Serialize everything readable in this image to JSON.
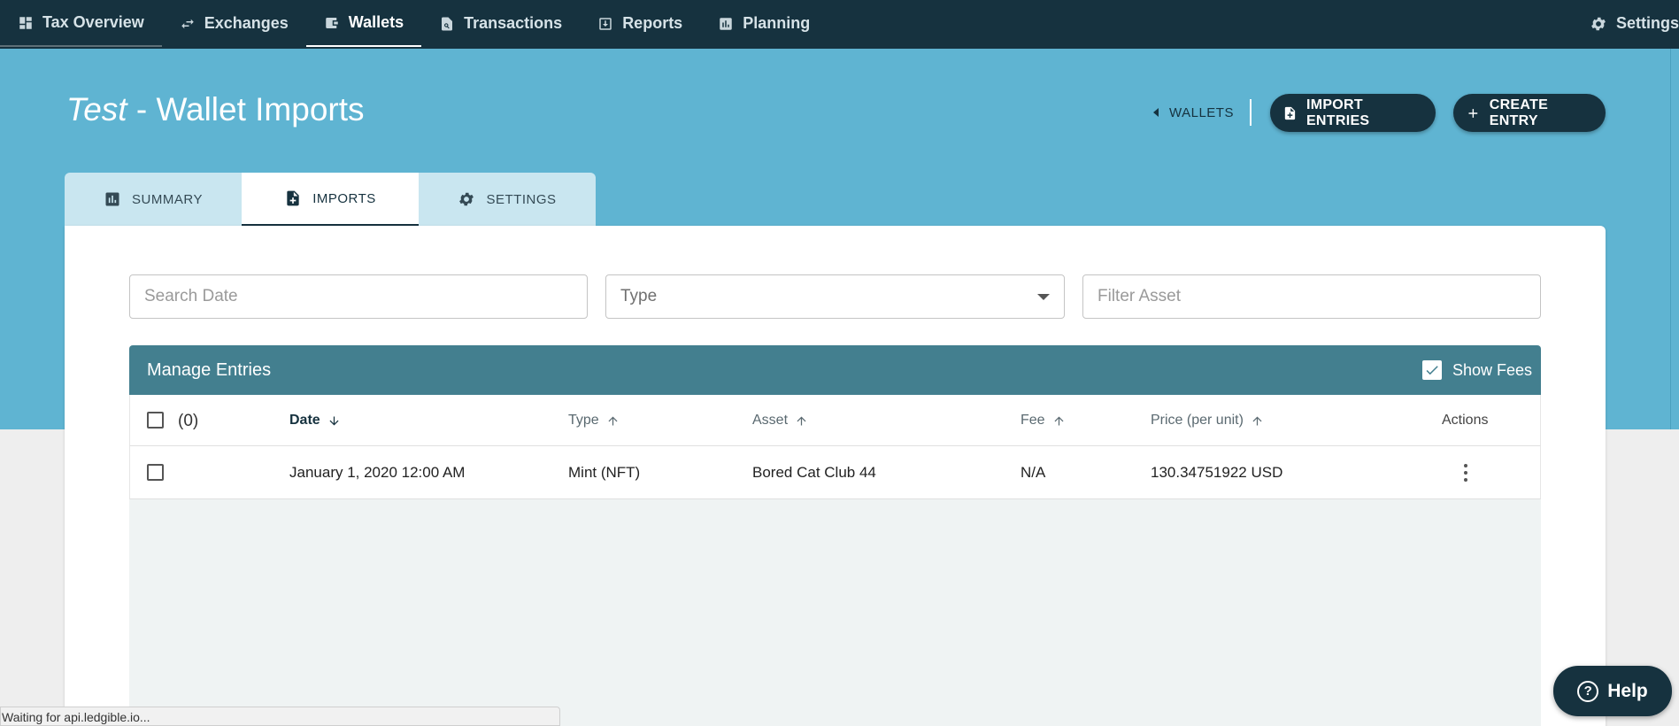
{
  "nav": {
    "items": [
      {
        "label": "Tax Overview",
        "icon": "dashboard-icon"
      },
      {
        "label": "Exchanges",
        "icon": "swap-icon"
      },
      {
        "label": "Wallets",
        "icon": "wallet-icon",
        "active": true
      },
      {
        "label": "Transactions",
        "icon": "search-document-icon"
      },
      {
        "label": "Reports",
        "icon": "report-download-icon"
      },
      {
        "label": "Planning",
        "icon": "bar-chart-icon"
      }
    ],
    "settings_label": "Settings"
  },
  "header": {
    "title_italic": "Test",
    "title_rest": " - Wallet Imports",
    "back_label": "WALLETS",
    "import_label": "IMPORT ENTRIES",
    "create_label": "CREATE ENTRY"
  },
  "tabs": [
    {
      "label": "SUMMARY",
      "icon": "bar-chart-icon"
    },
    {
      "label": "IMPORTS",
      "icon": "file-add-icon",
      "active": true
    },
    {
      "label": "SETTINGS",
      "icon": "gear-icon"
    }
  ],
  "filters": {
    "date_placeholder": "Search Date",
    "type_label": "Type",
    "asset_placeholder": "Filter Asset"
  },
  "table": {
    "title": "Manage Entries",
    "show_fees_label": "Show Fees",
    "selected_count": "(0)",
    "columns": {
      "date": "Date",
      "type": "Type",
      "asset": "Asset",
      "fee": "Fee",
      "price": "Price (per unit)",
      "actions": "Actions"
    },
    "rows": [
      {
        "date": "January 1, 2020 12:00 AM",
        "type": "Mint (NFT)",
        "asset": "Bored Cat Club 44",
        "fee": "N/A",
        "price": "130.34751922 USD"
      }
    ]
  },
  "help_label": "Help",
  "status_text": "Waiting for api.ledgible.io...",
  "colors": {
    "nav_bg": "#16323f",
    "hero_bg": "#5fb4d2",
    "table_header_bg": "#437f8f"
  }
}
